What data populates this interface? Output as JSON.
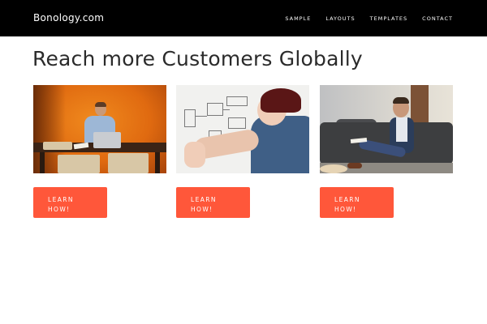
{
  "navbar": {
    "brand": "Bonology.com",
    "links": [
      "SAMPLE",
      "LAYOUTS",
      "TEMPLATES",
      "CONTACT"
    ]
  },
  "hero": {
    "headline": "Reach more Customers Globally"
  },
  "cards": [
    {
      "photo": "man-at-desk-with-laptop-photo",
      "cta_line1": "LEARN",
      "cta_line2": "HOW!"
    },
    {
      "photo": "man-drawing-on-whiteboard-photo",
      "cta_line1": "LEARN",
      "cta_line2": "HOW!"
    },
    {
      "photo": "man-on-couch-with-notepad-photo",
      "cta_line1": "LEARN",
      "cta_line2": "HOW!"
    }
  ],
  "colors": {
    "navbar_bg": "#000000",
    "accent": "#ff573a",
    "headline": "#2b2b2b"
  }
}
